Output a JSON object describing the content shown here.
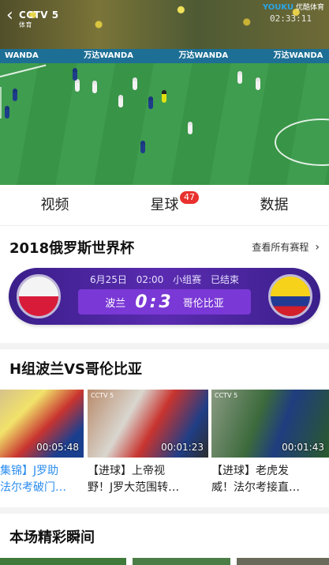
{
  "player": {
    "channel": "CCTV 5",
    "channel_sub": "体育",
    "watermark_brand": "YOUKU",
    "watermark_sub": "优酷体育",
    "watermark_time": "02:33:11",
    "board_texts": [
      "WANDA",
      "万达WANDA",
      "万达WANDA",
      "万达WANDA"
    ]
  },
  "tabs": [
    {
      "label": "视频"
    },
    {
      "label": "星球",
      "badge": "47"
    },
    {
      "label": "数据"
    }
  ],
  "event": {
    "title": "2018俄罗斯世界杯",
    "see_all": "查看所有赛程",
    "chevron": "›"
  },
  "match": {
    "date": "6月25日",
    "time": "02:00",
    "stage": "小组赛",
    "status": "已结束",
    "home_team": "波兰",
    "away_team": "哥伦比亚",
    "home_score": "0",
    "away_score": "3",
    "separator": ":"
  },
  "group_section": {
    "title": "H组波兰VS哥伦比亚",
    "videos": [
      {
        "duration": "00:05:48",
        "caption_line1": "集锦】J罗助",
        "caption_line2": "法尔考破门…"
      },
      {
        "duration": "00:01:23",
        "caption_line1": "【进球】上帝视",
        "caption_line2": "野！J罗大范围转…"
      },
      {
        "duration": "00:01:43",
        "caption_line1": "【进球】老虎发",
        "caption_line2": "威！法尔考接直…"
      }
    ]
  },
  "highlights": {
    "title": "本场精彩瞬间"
  },
  "colors": {
    "accent_red": "#e8312e",
    "accent_blue": "#2a8cf0",
    "card_purple": "#5a2bb0"
  }
}
